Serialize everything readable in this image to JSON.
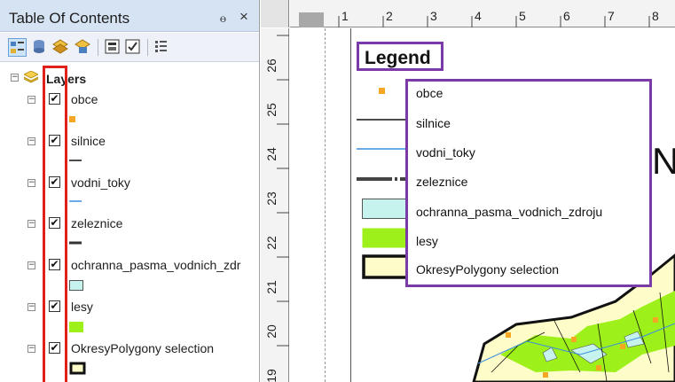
{
  "toc": {
    "title": "Table Of Contents",
    "pin_glyph": "📌",
    "close_glyph": "×",
    "toolbar_icons": [
      "list-by-drawing-order-icon",
      "list-by-source-icon",
      "list-by-visibility-icon",
      "list-by-selection-icon",
      "options-icon",
      "toggle-icon",
      "list-icon"
    ],
    "root_label": "Layers",
    "check_glyph": "✔",
    "expander_glyph": "−",
    "layers": [
      {
        "label": "obce",
        "checked": true,
        "symbol": "orange-point"
      },
      {
        "label": "silnice",
        "checked": true,
        "symbol": "black-line"
      },
      {
        "label": "vodni_toky",
        "checked": true,
        "symbol": "blue-line"
      },
      {
        "label": "zeleznice",
        "checked": true,
        "symbol": "railway-line"
      },
      {
        "label": "ochranna_pasma_vodnich_zdr",
        "checked": true,
        "symbol": "cyan-polygon"
      },
      {
        "label": "lesy",
        "checked": true,
        "symbol": "green-polygon"
      },
      {
        "label": "OkresyPolygony selection",
        "checked": true,
        "symbol": "yellow-polygon-thick-outline"
      }
    ]
  },
  "layout": {
    "hruler_ticks": [
      "1",
      "2",
      "3",
      "4",
      "5",
      "6",
      "7",
      "8"
    ],
    "vruler_ticks": [
      "26",
      "25",
      "24",
      "23",
      "22",
      "21",
      "20",
      "19"
    ],
    "legend_title": "Legend",
    "legend_items": [
      {
        "label": "obce"
      },
      {
        "label": "silnice"
      },
      {
        "label": "vodni_toky"
      },
      {
        "label": "zeleznice"
      },
      {
        "label": "ochranna_pasma_vodnich_zdroju"
      },
      {
        "label": "lesy"
      },
      {
        "label": "OkresyPolygony selection"
      }
    ],
    "map_text_fragment": "N"
  },
  "colors": {
    "highlight_red": "#e0201b",
    "highlight_purple": "#7a3aa8",
    "point_orange": "#f5a623",
    "water_blue": "#3b8ee0",
    "protection_cyan": "#c6f3ee",
    "forest_green": "#9ef01a",
    "district_yellow": "#fefcc8"
  }
}
